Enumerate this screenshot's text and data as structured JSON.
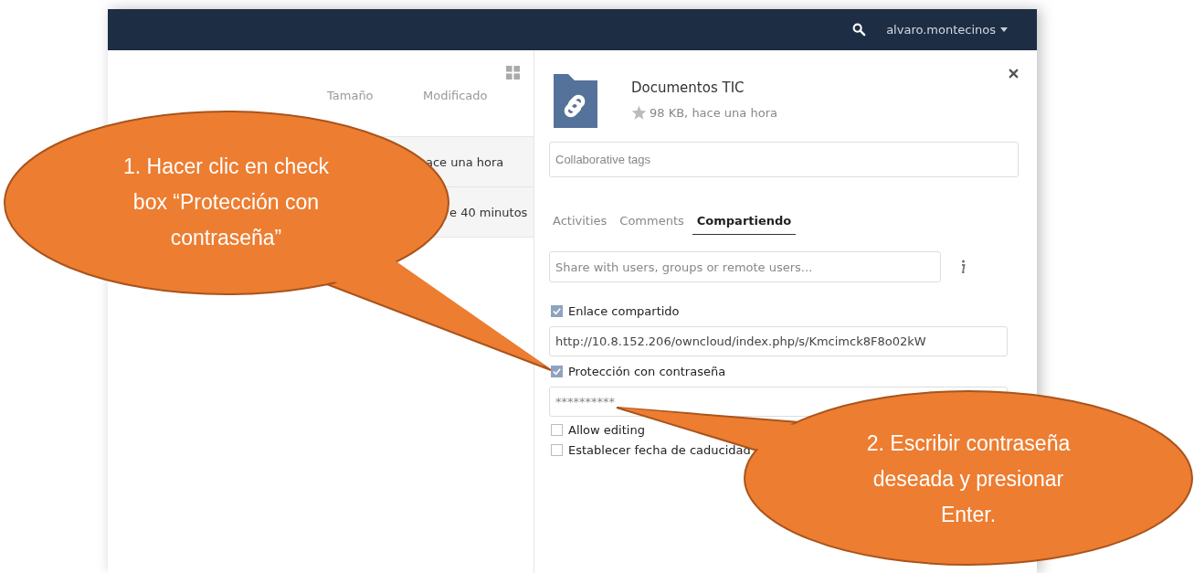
{
  "header": {
    "user": "alvaro.montecinos"
  },
  "file_list": {
    "columns": [
      "Tamaño",
      "Modificado"
    ],
    "rows": [
      {
        "modified": "ace una hora"
      },
      {
        "modified": "e 40 minutos"
      }
    ]
  },
  "details": {
    "title": "Documentos TIC",
    "starred": false,
    "meta": "98 KB, hace una hora",
    "tags_placeholder": "Collaborative tags",
    "tabs": [
      {
        "label": "Activities",
        "selected": false
      },
      {
        "label": "Comments",
        "selected": false
      },
      {
        "label": "Compartiendo",
        "selected": true
      }
    ],
    "share_placeholder": "Share with users, groups or remote users...",
    "options": [
      {
        "kind": "checkbox",
        "label": "Enlace compartido",
        "checked": true
      },
      {
        "kind": "field",
        "value": "http://10.8.152.206/owncloud/index.php/s/Kmcimck8F8o02kW"
      },
      {
        "kind": "checkbox",
        "label": "Protección con contraseña",
        "checked": true
      },
      {
        "kind": "password",
        "placeholder": "**********"
      },
      {
        "kind": "checkbox",
        "label": "Allow editing",
        "checked": false
      },
      {
        "kind": "checkbox",
        "label": "Establecer fecha de caducidad",
        "checked": false
      }
    ]
  },
  "callouts": [
    {
      "text": "1. Hacer clic en check box “Protección con contraseña”"
    },
    {
      "text": "2. Escribir contraseña deseada y presionar Enter."
    }
  ]
}
